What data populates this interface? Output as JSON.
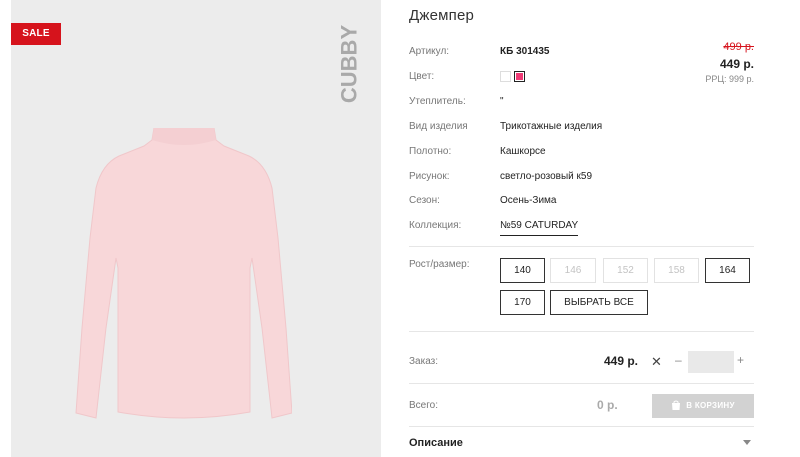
{
  "gallery": {
    "badge": "SALE",
    "brand": "CUBBY",
    "garment_color": "#f8d7d9"
  },
  "product": {
    "title": "Джемпер"
  },
  "price": {
    "old": "499 р.",
    "current": "449 р.",
    "rrc": "РРЦ: 999 р."
  },
  "attributes": {
    "article": {
      "label": "Артикул:",
      "value": "КБ 301435"
    },
    "color": {
      "label": "Цвет:",
      "swatches": [
        {
          "color": "#ffffff",
          "selected": false
        },
        {
          "color": "#f03a76",
          "selected": true
        }
      ]
    },
    "insulation": {
      "label": "Утеплитель:",
      "value": "\""
    },
    "type": {
      "label": "Вид изделия",
      "value": "Трикотажные изделия"
    },
    "fabric": {
      "label": "Полотно:",
      "value": "Кашкорсе"
    },
    "pattern": {
      "label": "Рисунок:",
      "value": "светло-розовый к59"
    },
    "season": {
      "label": "Сезон:",
      "value": "Осень-Зима"
    },
    "collection": {
      "label": "Коллекция:",
      "value": "№59 CATURDAY"
    }
  },
  "sizes": {
    "label": "Рост/размер:",
    "items": [
      {
        "label": "140",
        "available": true
      },
      {
        "label": "146",
        "available": false
      },
      {
        "label": "152",
        "available": false
      },
      {
        "label": "158",
        "available": false
      },
      {
        "label": "164",
        "available": true
      },
      {
        "label": "170",
        "available": true
      }
    ],
    "select_all": "ВЫБРАТЬ ВСЕ"
  },
  "order": {
    "label": "Заказ:",
    "price": "449 р.",
    "times": "✕",
    "minus": "–",
    "plus": "+",
    "quantity": ""
  },
  "total": {
    "label": "Всего:",
    "value": "0 р.",
    "cart_button": "В КОРЗИНУ"
  },
  "description": {
    "title": "Описание"
  },
  "colors": {
    "sale_red": "#d6131c",
    "cart_disabled": "#d2d2d2"
  }
}
